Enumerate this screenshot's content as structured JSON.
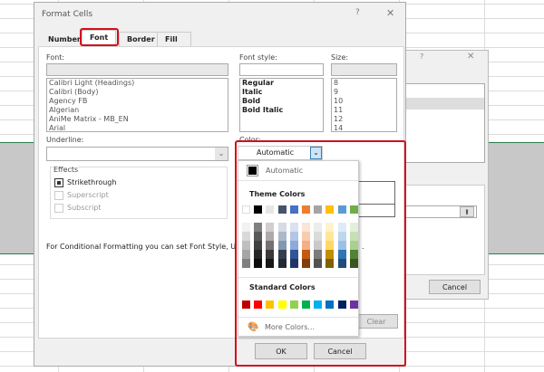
{
  "dialog": {
    "title": "Format Cells",
    "help": "?",
    "close": "✕",
    "tabs": [
      "Number",
      "Font",
      "Border",
      "Fill"
    ],
    "font_label": "Font:",
    "font_value": "",
    "fonts": [
      "Calibri Light (Headings)",
      "Calibri (Body)",
      "Agency FB",
      "Algerian",
      "AniMe Matrix - MB_EN",
      "Arial"
    ],
    "style_label": "Font style:",
    "style_value": "",
    "styles": [
      "Regular",
      "Italic",
      "Bold",
      "Bold Italic"
    ],
    "size_label": "Size:",
    "size_value": "",
    "sizes": [
      "8",
      "9",
      "10",
      "11",
      "12",
      "14"
    ],
    "underline_label": "Underline:",
    "underline_value": "",
    "color_label": "Color:",
    "color_value": "Automatic",
    "effects_label": "Effects",
    "effects": [
      {
        "label": "Strikethrough",
        "checked": true,
        "enabled": true
      },
      {
        "label": "Superscript",
        "checked": false,
        "enabled": false
      },
      {
        "label": "Subscript",
        "checked": false,
        "enabled": false
      }
    ],
    "note": "For Conditional Formatting you can set Font Style, U",
    "note_tail": ".",
    "clear": "Clear",
    "ok": "OK",
    "cancel": "Cancel"
  },
  "back_dialog": {
    "help": "?",
    "close": "✕",
    "cancel": "Cancel"
  },
  "palette": {
    "automatic": "Automatic",
    "theme_label": "Theme Colors",
    "standard_label": "Standard Colors",
    "more": "More Colors...",
    "theme": [
      "#FFFFFF",
      "#000000",
      "#E7E6E6",
      "#44546A",
      "#4472C4",
      "#ED7D31",
      "#A5A5A5",
      "#FFC000",
      "#5B9BD5",
      "#70AD47"
    ],
    "shades": [
      [
        "#F2F2F2",
        "#808080",
        "#D0CECE",
        "#D6DCE4",
        "#D9E1F2",
        "#FCE4D6",
        "#EDEDED",
        "#FFF2CC",
        "#DDEBF7",
        "#E2EFDA"
      ],
      [
        "#D9D9D9",
        "#595959",
        "#AEAAAA",
        "#ACB9CA",
        "#B4C6E7",
        "#F8CBAD",
        "#DBDBDB",
        "#FFE699",
        "#BDD7EE",
        "#C6E0B4"
      ],
      [
        "#BFBFBF",
        "#404040",
        "#757171",
        "#8497B0",
        "#8EA9DB",
        "#F4B084",
        "#C9C9C9",
        "#FFD966",
        "#9BC2E6",
        "#A9D08E"
      ],
      [
        "#A6A6A6",
        "#262626",
        "#3A3838",
        "#333F4F",
        "#305496",
        "#C65911",
        "#7B7B7B",
        "#BF8F00",
        "#2F75B5",
        "#548235"
      ],
      [
        "#808080",
        "#0D0D0D",
        "#161616",
        "#222B35",
        "#203764",
        "#833C0C",
        "#525252",
        "#806000",
        "#1F4E78",
        "#375623"
      ]
    ],
    "standard": [
      "#C00000",
      "#FF0000",
      "#FFC000",
      "#FFFF00",
      "#92D050",
      "#00B050",
      "#00B0F0",
      "#0070C0",
      "#002060",
      "#7030A0"
    ]
  },
  "highlight_color": "#D0101C"
}
